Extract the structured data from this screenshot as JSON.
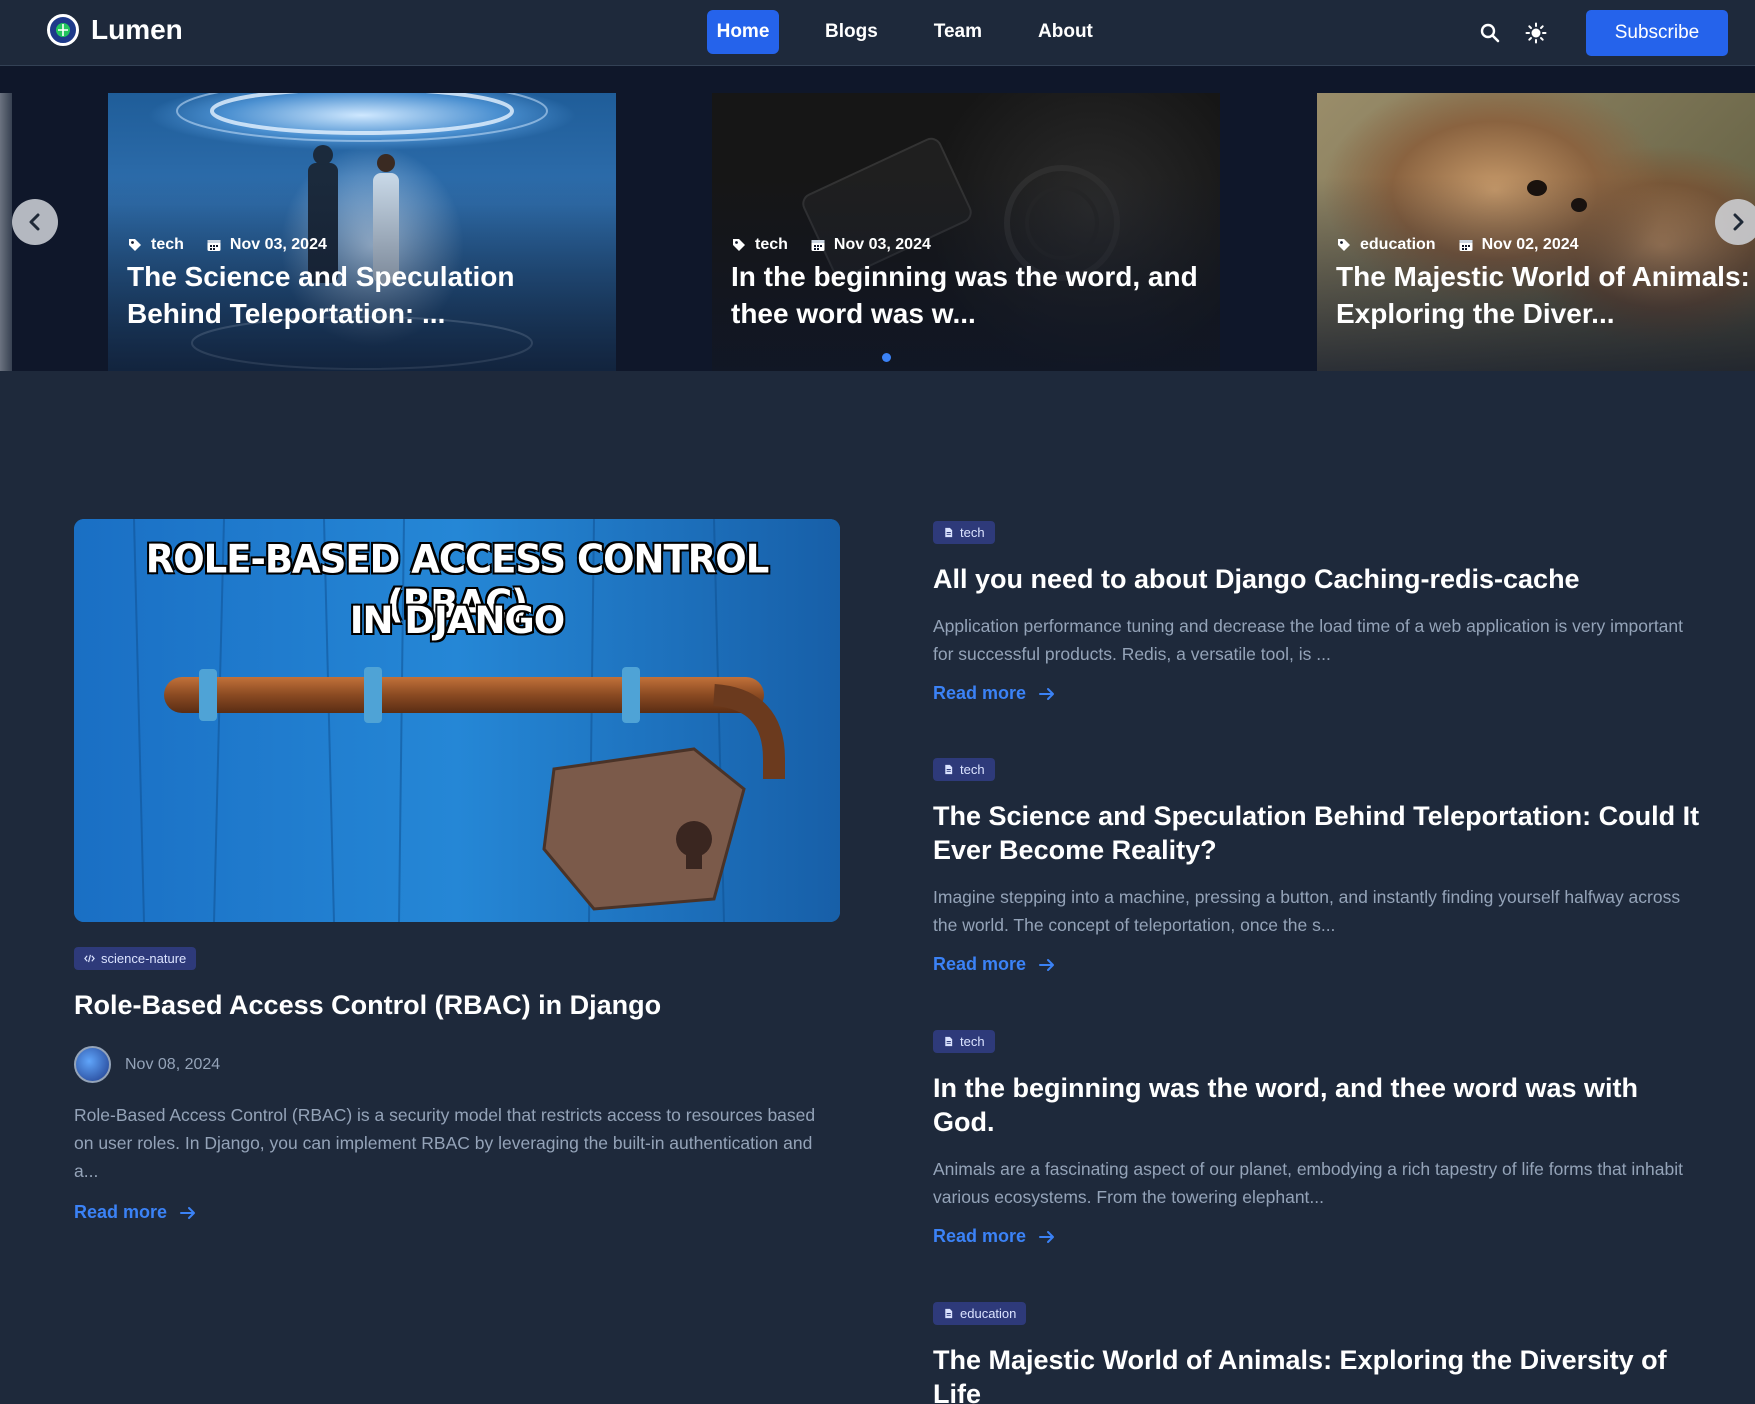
{
  "brand": {
    "name": "Lumen"
  },
  "nav": {
    "links": [
      {
        "label": "Home",
        "active": true
      },
      {
        "label": "Blogs"
      },
      {
        "label": "Team"
      },
      {
        "label": "About"
      }
    ],
    "subscribe_label": "Subscribe",
    "icons": [
      "search-icon",
      "sun-icon"
    ]
  },
  "carousel": {
    "slides": [
      {
        "category": "tech",
        "date": "Nov 03, 2024",
        "title": "The Science and Speculation Behind Teleportation: ..."
      },
      {
        "category": "tech",
        "date": "Nov 03, 2024",
        "title": "In the beginning was the word, and thee word was w..."
      },
      {
        "category": "education",
        "date": "Nov 02, 2024",
        "title": "The Majestic World of Animals: Exploring the Diver..."
      }
    ]
  },
  "featured": {
    "image_text_line1": "ROLE-BASED ACCESS CONTROL (RBAC)",
    "image_text_line2": "IN DJANGO",
    "tag": "science-nature",
    "title": "Role-Based Access Control (RBAC) in Django",
    "date": "Nov 08, 2024",
    "excerpt": "Role-Based Access Control (RBAC) is a security model that restricts access to resources based on user roles. In Django, you can implement RBAC by leveraging the built-in authentication and a...",
    "read_more": "Read more"
  },
  "posts": [
    {
      "tag": "tech",
      "title": "All you need to about Django Caching-redis-cache",
      "excerpt": "Application performance tuning and decrease the load time of a web application is very important for successful products. Redis, a versatile tool, is ...",
      "read_more": "Read more"
    },
    {
      "tag": "tech",
      "title": "The Science and Speculation Behind Teleportation: Could It Ever Become Reality?",
      "excerpt": "Imagine stepping into a machine, pressing a button, and instantly finding yourself halfway across the world. The concept of teleportation, once the s...",
      "read_more": "Read more"
    },
    {
      "tag": "tech",
      "title": "In the beginning was the word, and thee word was with God.",
      "excerpt": "Animals are a fascinating aspect of our planet, embodying a rich tapestry of life forms that inhabit various ecosystems. From the towering elephant...",
      "read_more": "Read more"
    },
    {
      "tag": "education",
      "title": "The Majestic World of Animals: Exploring the Diversity of Life"
    }
  ],
  "colors": {
    "accent": "#2563eb",
    "background": "#1e293b",
    "tag_bg": "#2e3a7a"
  }
}
